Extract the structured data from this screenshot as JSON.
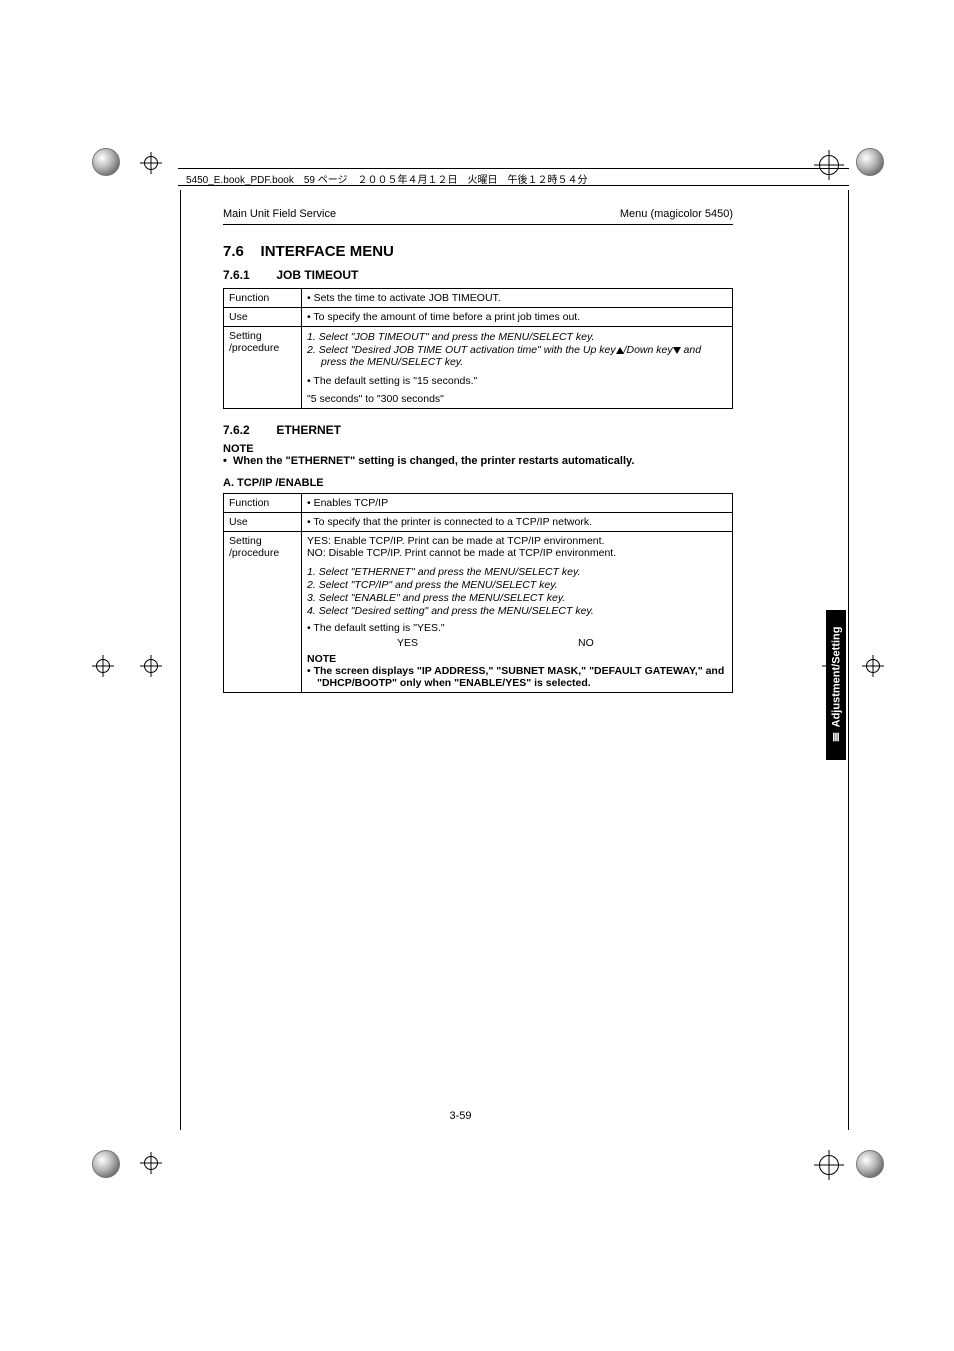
{
  "crop_header": "5450_E.book_PDF.book　59 ページ　２００５年４月１２日　火曜日　午後１２時５４分",
  "header": {
    "left": "Main Unit Field Service",
    "right": "Menu (magicolor 5450)"
  },
  "section": {
    "num": "7.6",
    "title": "INTERFACE MENU"
  },
  "sub1": {
    "num": "7.6.1",
    "title": "JOB TIMEOUT"
  },
  "table1": {
    "function_lbl": "Function",
    "function_val": "Sets the time to activate JOB TIMEOUT.",
    "use_lbl": "Use",
    "use_val": "To specify the amount of time before a print job times out.",
    "proc_lbl": "Setting /procedure",
    "step1": "Select \"JOB TIMEOUT\" and press the MENU/SELECT key.",
    "step2a": "Select \"Desired JOB TIME OUT activation time\" with the Up key",
    "step2b": "/Down key",
    "step2c": " and press the MENU/SELECT key.",
    "default": "The default setting is \"15 seconds.\"",
    "range": "\"5 seconds\" to \"300 seconds\""
  },
  "sub2": {
    "num": "7.6.2",
    "title": "ETHERNET"
  },
  "note_lbl": "NOTE",
  "note_body": "When the \"ETHERNET\" setting is changed, the printer restarts automatically.",
  "sub3": "A.   TCP/IP /ENABLE",
  "table2": {
    "function_lbl": "Function",
    "function_val": "Enables TCP/IP",
    "use_lbl": "Use",
    "use_val": "To specify that the printer is connected to a TCP/IP network.",
    "proc_lbl": "Setting /procedure",
    "yes_line": "YES: Enable TCP/IP. Print can be made at TCP/IP environment.",
    "no_line": "NO: Disable TCP/IP. Print cannot be made at TCP/IP environment.",
    "s1": "Select \"ETHERNET\" and press the MENU/SELECT key.",
    "s2": "Select \"TCP/IP\" and press the MENU/SELECT key.",
    "s3": "Select \"ENABLE\" and press the MENU/SELECT key.",
    "s4": "Select \"Desired setting\" and press the MENU/SELECT key.",
    "default": "The default setting is \"YES.\"",
    "opt_yes": "YES",
    "opt_no": "NO",
    "inote_lbl": "NOTE",
    "inote_body": "The screen displays \"IP ADDRESS,\" \"SUBNET MASK,\" \"DEFAULT GATEWAY,\" and \"DHCP/BOOTP\" only when \"ENABLE/YES\" is selected."
  },
  "side_tab": "Ⅲ Adjustment/Setting",
  "pagenum": "3-59"
}
